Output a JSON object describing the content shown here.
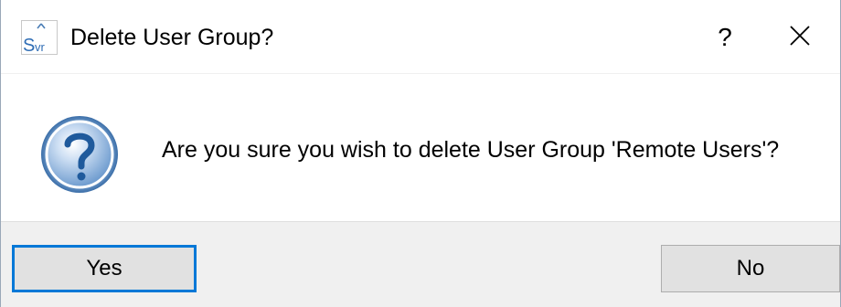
{
  "window": {
    "title": "Delete User Group?",
    "help_label": "?",
    "close_glyph": "✕",
    "app_icon": "svr-app-icon"
  },
  "content": {
    "message": "Are you sure you wish to delete User Group 'Remote Users'?",
    "icon": "question-icon"
  },
  "buttons": {
    "yes_label": "Yes",
    "no_label": "No"
  },
  "colors": {
    "focus_border": "#0078d7",
    "footer_bg": "#f0f0f0",
    "button_bg": "#e1e1e1"
  }
}
